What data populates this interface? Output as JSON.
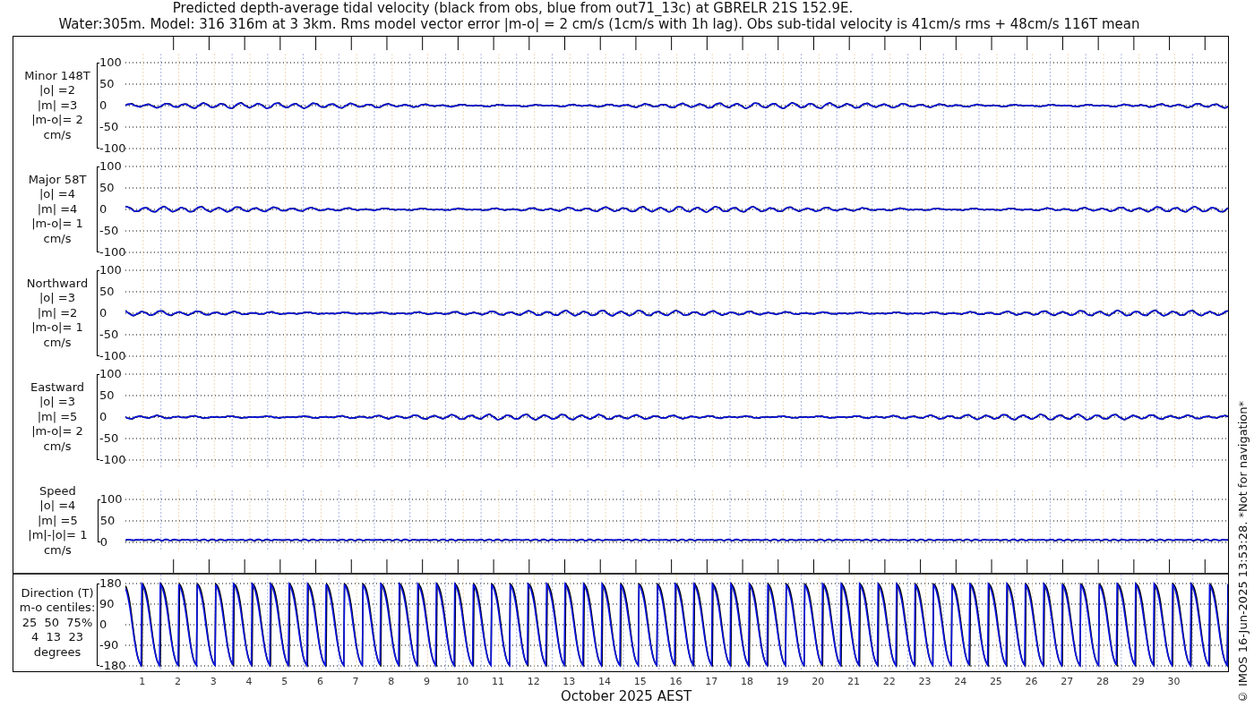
{
  "title": "Predicted depth-average tidal velocity (black from obs, blue from out71_13c) at GBRELR 21S 152.9E.",
  "subtitle": "Water:305m. Model: 316 316m at 3 3km. Rms model vector error |m-o| = 2 cm/s (1cm/s with 1h lag). Obs sub-tidal velocity is 41cm/s rms + 48cm/s 116T mean",
  "panels": [
    {
      "kind": "velocity",
      "label_lines": [
        "Minor 148T",
        "|o| =2",
        "|m| =3",
        "|m-o|= 2",
        "cm/s"
      ],
      "yticks": [
        "100",
        "50",
        "0",
        "-50",
        "-100"
      ]
    },
    {
      "kind": "velocity",
      "label_lines": [
        "Major 58T",
        "|o| =4",
        "|m| =4",
        "|m-o|= 1",
        "cm/s"
      ],
      "yticks": [
        "100",
        "50",
        "0",
        "-50",
        "-100"
      ]
    },
    {
      "kind": "velocity",
      "label_lines": [
        "Northward",
        "|o| =3",
        "|m| =2",
        "|m-o|= 1",
        "cm/s"
      ],
      "yticks": [
        "100",
        "50",
        "0",
        "-50",
        "-100"
      ]
    },
    {
      "kind": "velocity",
      "label_lines": [
        "Eastward",
        "|o| =3",
        "|m| =5",
        "|m-o|= 2",
        "cm/s"
      ],
      "yticks": [
        "100",
        "50",
        "0",
        "-50",
        "-100"
      ]
    },
    {
      "kind": "speed",
      "label_lines": [
        "Speed",
        "|o| =4",
        "|m| =5",
        "|m|-|o|= 1",
        "cm/s"
      ],
      "yticks": [
        "100",
        "50",
        "0"
      ]
    }
  ],
  "direction_panel": {
    "kind": "direction",
    "label_lines": [
      "Direction (T)",
      "m-o centiles:",
      "25  50  75%",
      "4  13  23",
      "degrees"
    ],
    "yticks": [
      "180",
      "90",
      "0",
      "-90",
      "-180"
    ]
  },
  "days": [
    "1",
    "2",
    "3",
    "4",
    "5",
    "6",
    "7",
    "8",
    "9",
    "10",
    "11",
    "12",
    "13",
    "14",
    "15",
    "16",
    "17",
    "18",
    "19",
    "20",
    "21",
    "22",
    "23",
    "24",
    "25",
    "26",
    "27",
    "28",
    "29",
    "30"
  ],
  "xlabel": "October 2025 AEST",
  "credit": "© IMOS 16-Jun-2025 13:53:28. *Not for navigation*"
}
